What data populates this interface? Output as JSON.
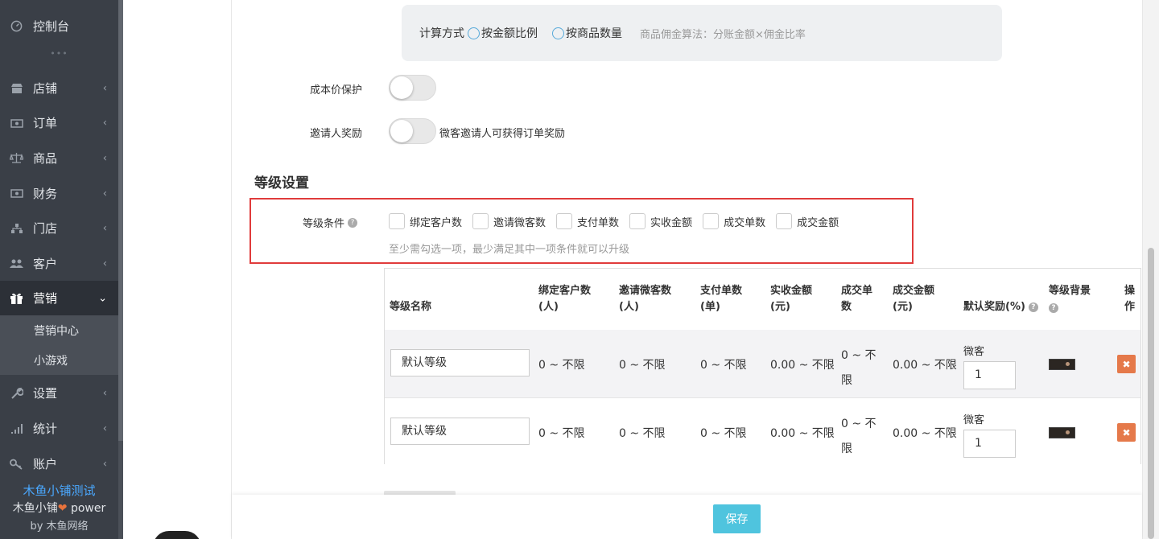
{
  "sidebar": {
    "dashboard": "控制台",
    "dots": "•••",
    "items": [
      {
        "label": "店铺",
        "icon": "shop-icon"
      },
      {
        "label": "订单",
        "icon": "order-icon"
      },
      {
        "label": "商品",
        "icon": "scale-icon"
      },
      {
        "label": "财务",
        "icon": "money-icon"
      },
      {
        "label": "门店",
        "icon": "sitemap-icon"
      },
      {
        "label": "客户",
        "icon": "users-icon"
      },
      {
        "label": "营销",
        "icon": "gift-icon"
      },
      {
        "label": "设置",
        "icon": "wrench-icon"
      },
      {
        "label": "统计",
        "icon": "signal-icon"
      },
      {
        "label": "账户",
        "icon": "key-icon"
      }
    ],
    "submenu": [
      "营销中心",
      "小游戏"
    ],
    "brand_name": "木鱼小铺测试",
    "brand_power_prefix": "木鱼小铺",
    "brand_power_suffix": " power",
    "brand_by": "by 木鱼网络"
  },
  "calc": {
    "label": "计算方式",
    "option1": "按金额比例",
    "option2": "按商品数量",
    "hint": "商品佣金算法：分账金额×佣金比率"
  },
  "cost_protect": {
    "label": "成本价保护"
  },
  "inviter_reward": {
    "label": "邀请人奖励",
    "desc": "微客邀请人可获得订单奖励"
  },
  "level_section": {
    "title": "等级设置"
  },
  "level_condition": {
    "label": "等级条件",
    "options": [
      "绑定客户数",
      "邀请微客数",
      "支付单数",
      "实收金额",
      "成交单数",
      "成交金额"
    ],
    "hint": "至少需勾选一项，最少满足其中一项条件就可以升级"
  },
  "table": {
    "headers": {
      "name": "等级名称",
      "bind_1": "绑定客户数",
      "bind_2": "(人)",
      "invite_1": "邀请微客数",
      "invite_2": "(人)",
      "pay_1": "支付单数",
      "pay_2": "(单)",
      "amount_1": "实收金额",
      "amount_2": "(元)",
      "deal_1": "成交单",
      "deal_2": "数",
      "dealamt_1": "成交金额",
      "dealamt_2": "(元)",
      "reward": "默认奖励(%)",
      "bg": "等级背景",
      "op_1": "操",
      "op_2": "作"
    },
    "rows": [
      {
        "name": "默认等级",
        "bind": "0 ~ 不限",
        "invite": "0 ~ 不限",
        "pay": "0 ~ 不限",
        "amount": "0.00 ~ 不限",
        "deal_1": "0 ~ 不",
        "deal_2": "限",
        "dealamt": "0.00 ~ 不限",
        "reward_label": "微客",
        "reward_value": "1"
      },
      {
        "name": "默认等级",
        "bind": "0 ~ 不限",
        "invite": "0 ~ 不限",
        "pay": "0 ~ 不限",
        "amount": "0.00 ~ 不限",
        "deal_1": "0 ~ 不",
        "deal_2": "限",
        "dealamt": "0.00 ~ 不限",
        "reward_label": "微客",
        "reward_value": "1"
      }
    ],
    "delete_glyph": "✖"
  },
  "footer": {
    "save": "保存"
  }
}
